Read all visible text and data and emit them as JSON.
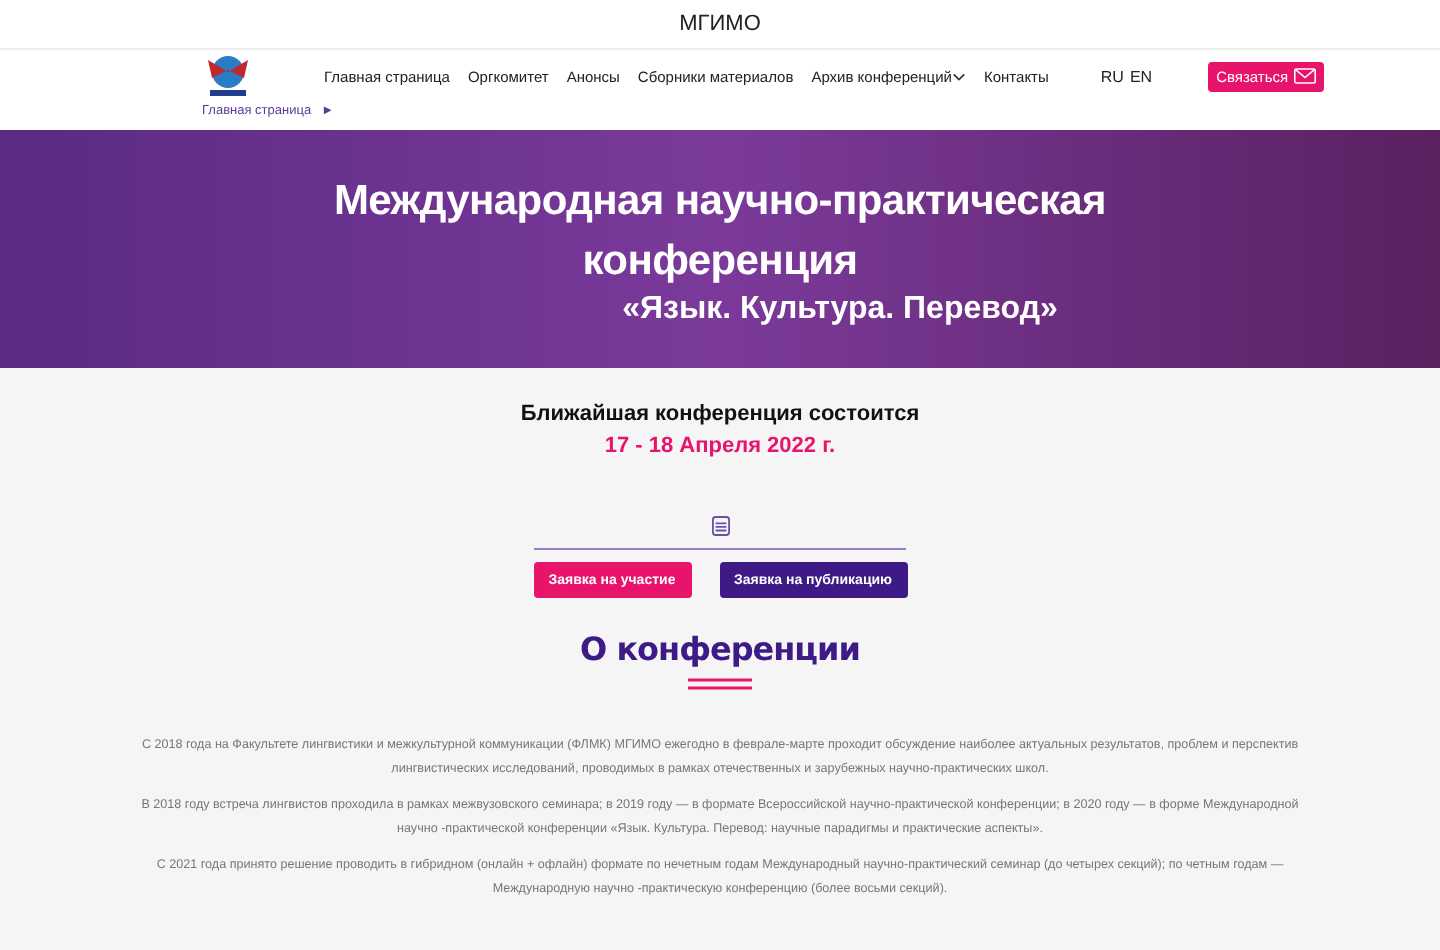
{
  "top_bar": {
    "title": "МГИМО"
  },
  "nav": {
    "items": [
      {
        "label": "Главная страница",
        "dropdown": false
      },
      {
        "label": "Оргкомитет",
        "dropdown": false
      },
      {
        "label": "Анонсы",
        "dropdown": false
      },
      {
        "label": "Сборники материалов",
        "dropdown": false
      },
      {
        "label": "Архив конференций",
        "dropdown": true
      },
      {
        "label": "Контакты",
        "dropdown": false
      }
    ],
    "languages": [
      "RU",
      "EN"
    ],
    "contact_button": "Связаться"
  },
  "breadcrumb": {
    "label": "Главная страница",
    "arrow": "►"
  },
  "hero": {
    "title": "Международная научно-практическая конференция",
    "subtitle": "«Язык. Культура. Перевод»"
  },
  "next": {
    "heading": "Ближайшая конференция состоится",
    "date": "17 - 18 Апреля 2022 г."
  },
  "buttons": [
    {
      "label": "Заявка на участие",
      "kind": "primary"
    },
    {
      "label": "Заявка на публикацию",
      "kind": "secondary"
    }
  ],
  "about": {
    "title": "О конференции",
    "paragraphs": [
      "С 2018 года на Факультете лингвистики и межкультурной коммуникации (ФЛМК) МГИМО ежегодно в феврале-марте проходит обсуждение наиболее актуальных результатов, проблем и перспектив лингвистических исследований, проводимых в рамках отечественных и зарубежных научно-практических школ.",
      "В 2018 году встреча лингвистов проходила в рамках межвузовского семинара; в 2019 году — в формате Всероссийской научно-практической конференции; в 2020 году — в форме Международной научно -практической конференции «Язык. Культура. Перевод: научные парадигмы и практические аспекты».",
      "С 2021 года принято решение проводить в гибридном (онлайн + офлайн) формате по нечетным годам Международный научно-практический семинар (до четырех секций); по четным годам — Международную научно -практическую конференцию (более восьми секций)."
    ]
  }
}
